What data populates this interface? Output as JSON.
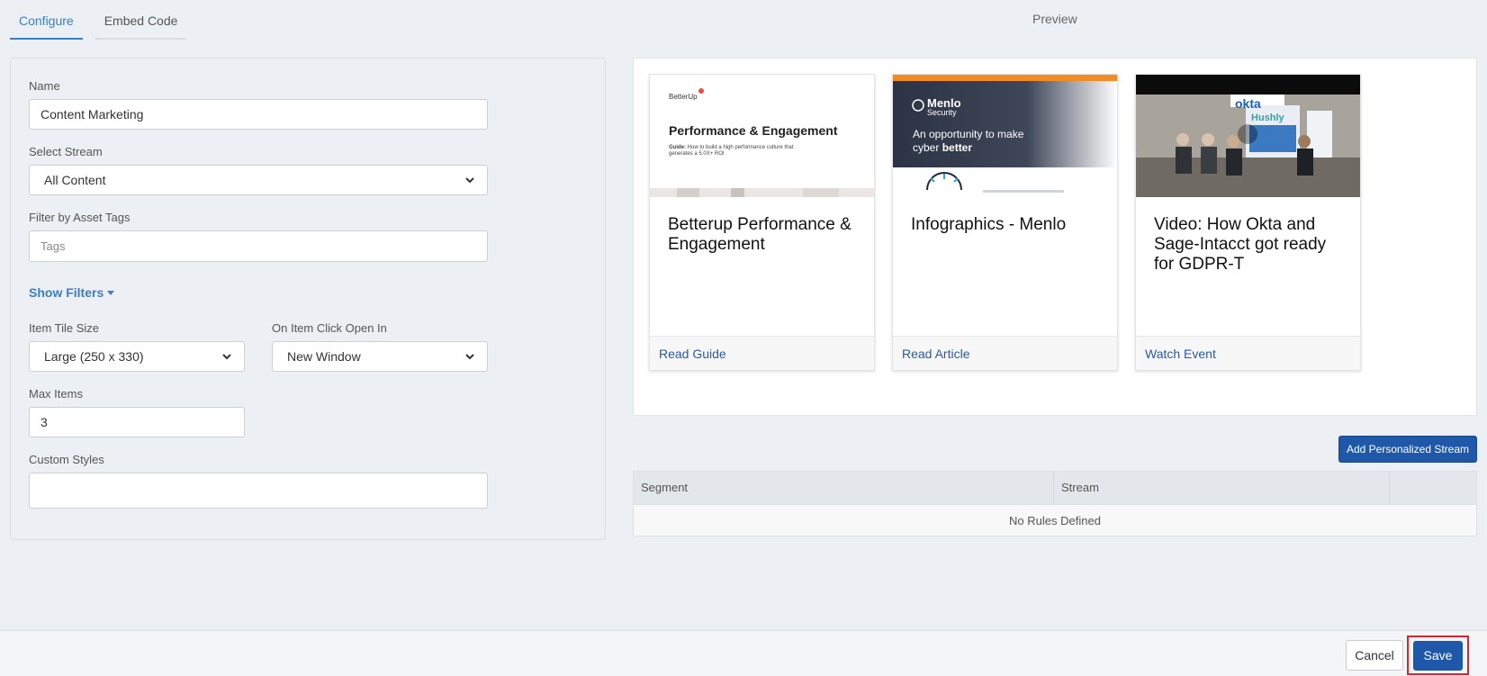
{
  "tabs": [
    {
      "label": "Configure",
      "active": true
    },
    {
      "label": "Embed Code",
      "active": false
    }
  ],
  "preview_title": "Preview",
  "form": {
    "name_label": "Name",
    "name_value": "Content Marketing",
    "stream_label": "Select Stream",
    "stream_value": "All Content",
    "tags_label": "Filter by Asset Tags",
    "tags_placeholder": "Tags",
    "show_filters": "Show Filters",
    "tile_size_label": "Item Tile Size",
    "tile_size_value": "Large (250 x 330)",
    "click_open_label": "On Item Click Open In",
    "click_open_value": "New Window",
    "max_items_label": "Max Items",
    "max_items_value": "3",
    "custom_styles_label": "Custom Styles",
    "custom_styles_value": ""
  },
  "cards": [
    {
      "title": "Betterup Performance & Engagement",
      "cta": "Read Guide",
      "thumb": {
        "brand": "BetterUp",
        "heading": "Performance & Engagement",
        "sub_bold": "Guide:",
        "sub": "How to build a high performance culture that generates a 5.0X+ ROI"
      }
    },
    {
      "title": "Infographics - Menlo",
      "cta": "Read Article",
      "thumb": {
        "brand": "Menlo",
        "brand_sub": "Security",
        "tagline_1": "An opportunity to make",
        "tagline_2": "cyber",
        "tagline_2_bold": "better"
      }
    },
    {
      "title": "Video: How Okta and Sage-Intacct got ready for GDPR-T",
      "cta": "Watch Event",
      "thumb": {
        "brand_1": "okta",
        "brand_2": "Hushly"
      }
    }
  ],
  "add_stream_button": "Add Personalized Stream",
  "rules_table": {
    "columns": [
      "Segment",
      "Stream",
      ""
    ],
    "empty_text": "No Rules Defined"
  },
  "footer": {
    "cancel": "Cancel",
    "save": "Save"
  },
  "colors": {
    "accent": "#3a7fc1",
    "primary_button": "#1f58a8",
    "highlight": "#d7262c",
    "link": "#2a5a9e"
  }
}
